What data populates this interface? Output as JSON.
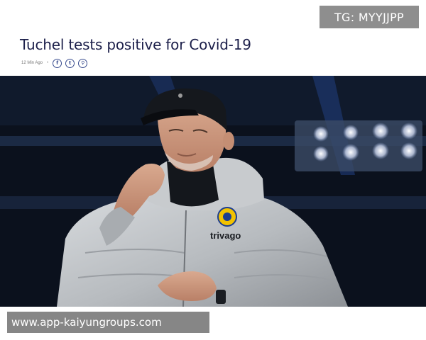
{
  "overlay": {
    "tg_badge": "TG: MYYJJPP",
    "url_bar": "www.app-kaiyungroups.com"
  },
  "article": {
    "headline": "Tuchel tests positive for Covid-19",
    "time_ago": "12 Min Ago",
    "separator": "•",
    "share_icons": [
      {
        "icon": "facebook-icon",
        "glyph": "f"
      },
      {
        "icon": "twitter-icon",
        "glyph": "t"
      },
      {
        "icon": "link-icon",
        "glyph": "⚲"
      }
    ]
  },
  "photo": {
    "jacket_sponsor": "trivago"
  },
  "colors": {
    "headline": "#1c1f4a",
    "share_icon": "#3a4d8f",
    "overlay_gray": "#8e8e8e"
  }
}
